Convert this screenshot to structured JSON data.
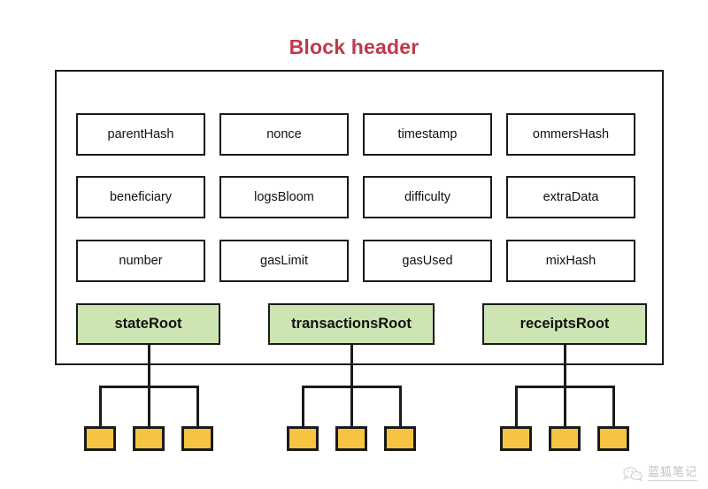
{
  "title": "Block header",
  "title_color": "#c0394b",
  "colors": {
    "root_fill": "#cce5b3",
    "leaf_fill": "#f6c342",
    "stroke": "#1a1a1a",
    "background": "#ffffff"
  },
  "header_fields": [
    {
      "label": "parentHash",
      "col": 0,
      "row": 0
    },
    {
      "label": "nonce",
      "col": 1,
      "row": 0
    },
    {
      "label": "timestamp",
      "col": 2,
      "row": 0
    },
    {
      "label": "ommersHash",
      "col": 3,
      "row": 0
    },
    {
      "label": "beneficiary",
      "col": 0,
      "row": 1
    },
    {
      "label": "logsBloom",
      "col": 1,
      "row": 1
    },
    {
      "label": "difficulty",
      "col": 2,
      "row": 1
    },
    {
      "label": "extraData",
      "col": 3,
      "row": 1
    },
    {
      "label": "number",
      "col": 0,
      "row": 2
    },
    {
      "label": "gasLimit",
      "col": 1,
      "row": 2
    },
    {
      "label": "gasUsed",
      "col": 2,
      "row": 2
    },
    {
      "label": "mixHash",
      "col": 3,
      "row": 2
    }
  ],
  "root_nodes": [
    {
      "label": "stateRoot",
      "leaf_count": 3
    },
    {
      "label": "transactionsRoot",
      "leaf_count": 3
    },
    {
      "label": "receiptsRoot",
      "leaf_count": 3
    }
  ],
  "watermark": {
    "icon": "wechat-icon",
    "text": "蓝狐笔记"
  }
}
